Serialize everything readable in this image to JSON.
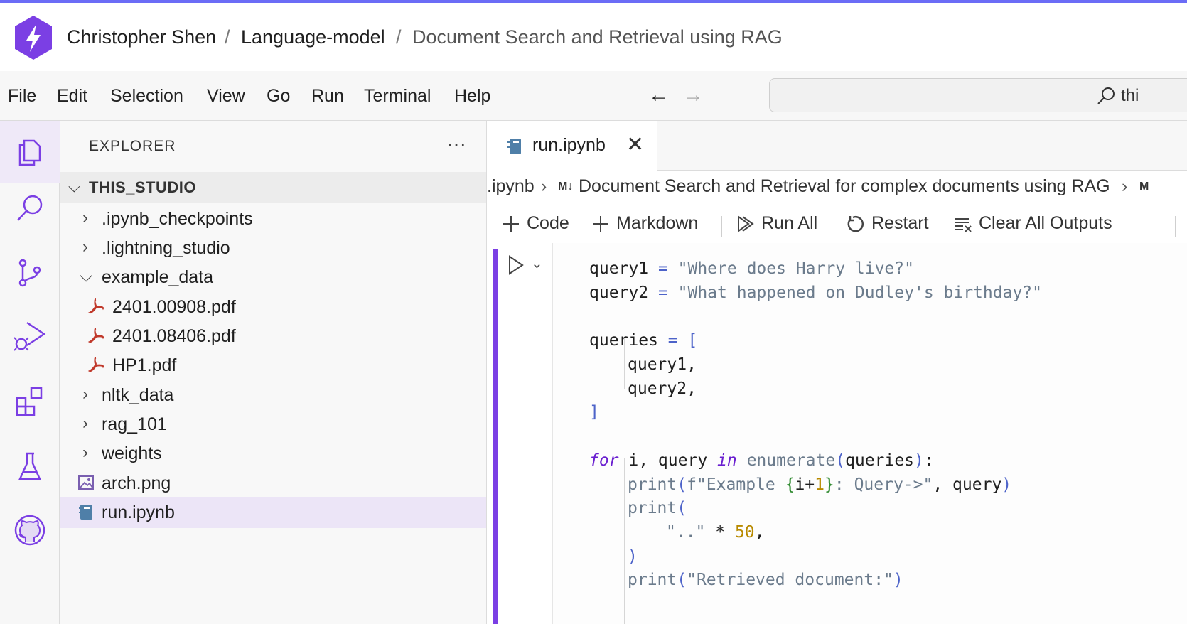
{
  "breadcrumb": {
    "user": "Christopher Shen",
    "project": "Language-model",
    "studio": "Document Search and Retrieval using RAG",
    "sep": "/"
  },
  "menu": [
    "File",
    "Edit",
    "Selection",
    "View",
    "Go",
    "Run",
    "Terminal",
    "Help"
  ],
  "search": {
    "text": "thi"
  },
  "explorer": {
    "title": "EXPLORER",
    "more": "···",
    "root": "THIS_STUDIO",
    "items": [
      {
        "name": ".ipynb_checkpoints",
        "kind": "folder",
        "state": "collapsed"
      },
      {
        "name": ".lightning_studio",
        "kind": "folder",
        "state": "collapsed"
      },
      {
        "name": "example_data",
        "kind": "folder",
        "state": "expanded"
      },
      {
        "name": "2401.00908.pdf",
        "kind": "pdf"
      },
      {
        "name": "2401.08406.pdf",
        "kind": "pdf"
      },
      {
        "name": "HP1.pdf",
        "kind": "pdf"
      },
      {
        "name": "nltk_data",
        "kind": "folder",
        "state": "collapsed"
      },
      {
        "name": "rag_101",
        "kind": "folder",
        "state": "collapsed"
      },
      {
        "name": "weights",
        "kind": "folder",
        "state": "collapsed"
      },
      {
        "name": "arch.png",
        "kind": "image"
      },
      {
        "name": "run.ipynb",
        "kind": "notebook",
        "selected": true
      }
    ]
  },
  "tab": {
    "label": "run.ipynb",
    "close": "✕"
  },
  "nb_breadcrumb": {
    "file": ".ipynb",
    "md_badge": "M↓",
    "section": "Document Search and Retrieval for complex documents using RAG",
    "trail_badge": "M"
  },
  "toolbar": {
    "code": "Code",
    "markdown": "Markdown",
    "run_all": "Run All",
    "restart": "Restart",
    "clear": "Clear All Outputs"
  },
  "code": {
    "query1_var": "query1",
    "query1_str": "\"Where does Harry live?\"",
    "query2_var": "query2",
    "query2_str": "\"What happened on Dudley's birthday?\"",
    "queries_var": "queries",
    "list_open": "[",
    "item1": "query1,",
    "item2": "query2,",
    "list_close": "]",
    "kw_for": "for",
    "loop_vars": " i, query ",
    "kw_in": "in",
    "fn_enumerate": " enumerate",
    "loop_arg": "queries",
    "colon": ":",
    "fn_print": "print",
    "fstr_a": "f\"Example ",
    "fstr_i": "i+",
    "fstr_num": "1",
    "fstr_b": ": Query->\"",
    "print_arg": ", query",
    "dots": "\"..\"",
    "star": " * ",
    "fifty": "50",
    "comma": ",",
    "close_paren": ")",
    "retrieved": "\"Retrieved document:\""
  },
  "colors": {
    "accent": "#7b3fe4",
    "top_accent": "#6b6cf6",
    "pdf": "#c0392b",
    "notebook": "#4f7fa8"
  }
}
